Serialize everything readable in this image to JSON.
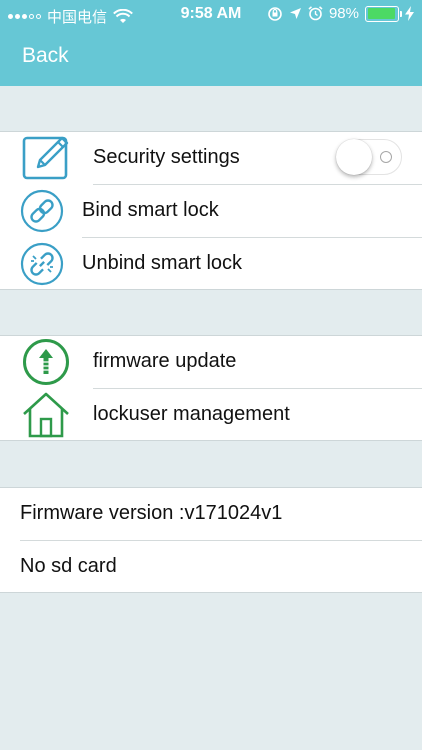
{
  "status_bar": {
    "carrier": "中国电信",
    "time": "9:58 AM",
    "battery": "98%",
    "icons": [
      "signal-icon",
      "wifi-icon",
      "orientation-lock-icon",
      "location-icon",
      "alarm-icon",
      "battery-icon",
      "charging-icon"
    ]
  },
  "nav": {
    "back_label": "Back"
  },
  "colors": {
    "header": "#66c7d5",
    "background": "#e3ecee",
    "icon_accent": "#3a9fc6",
    "icon_green": "#2e9a4a"
  },
  "smart_lock": {
    "security_settings": {
      "label": "Security settings",
      "toggle_on": false
    },
    "bind": {
      "label": "Bind smart lock"
    },
    "unbind": {
      "label": "Unbind smart lock"
    }
  },
  "device": {
    "firmware_update": {
      "label": "firmware update"
    },
    "lockuser_management": {
      "label": "lockuser management"
    }
  },
  "info": {
    "firmware_version": "Firmware version :v171024v1",
    "sd_card": "No sd card"
  }
}
